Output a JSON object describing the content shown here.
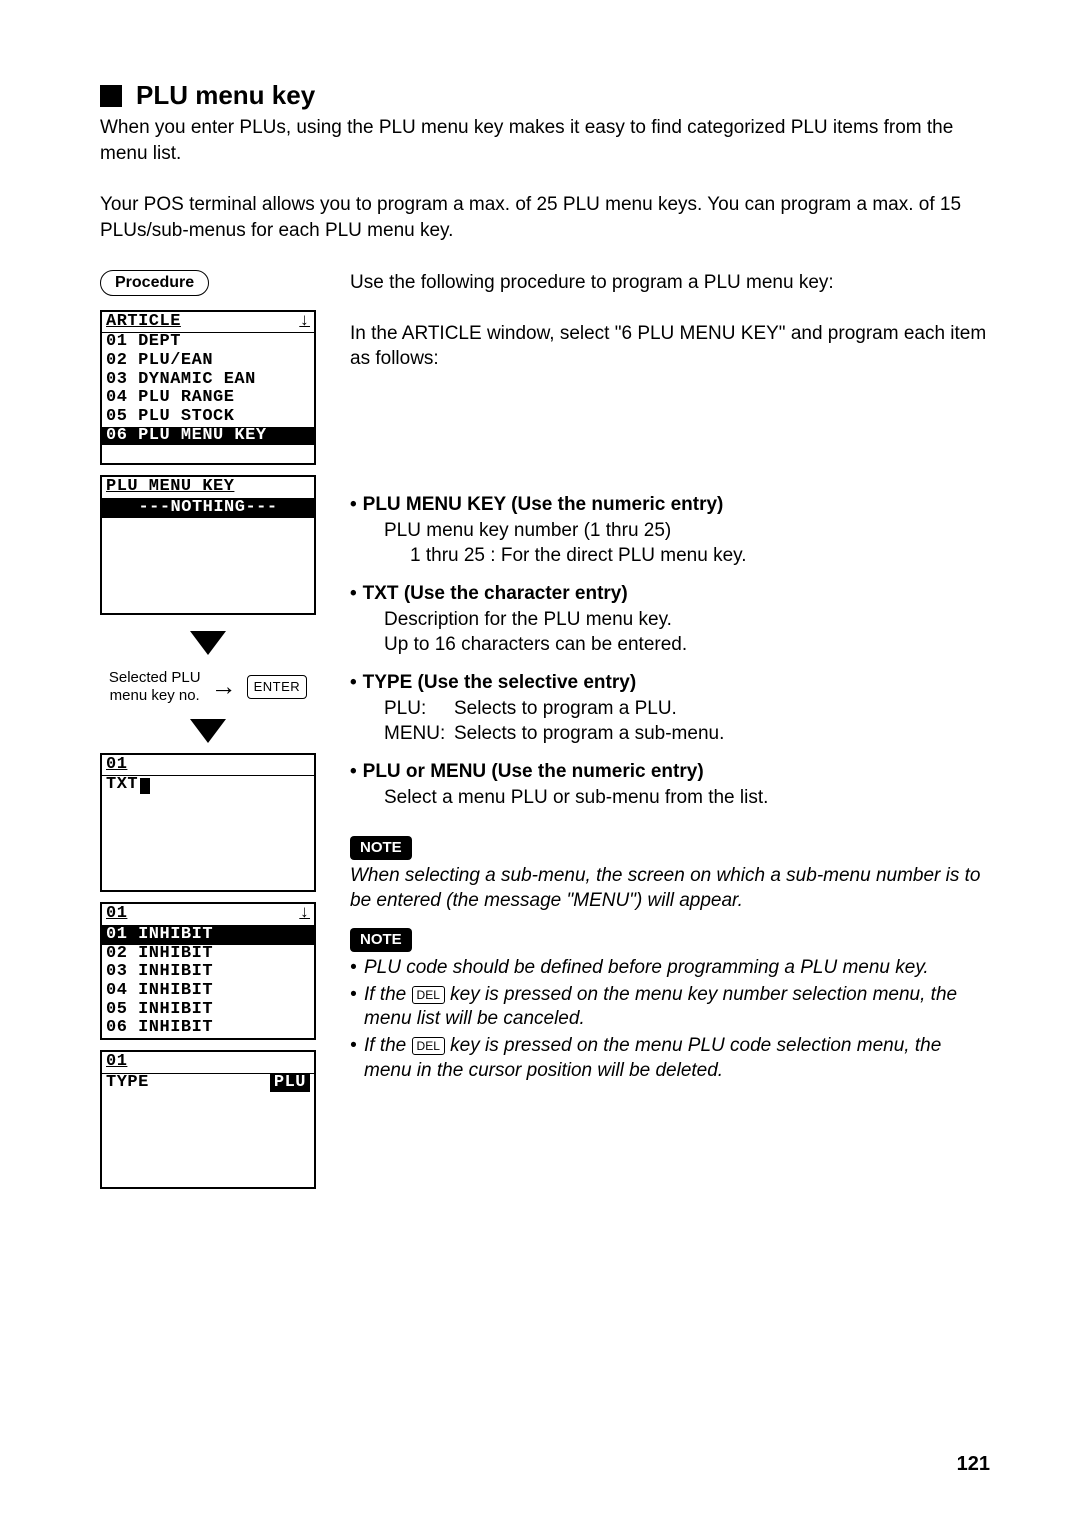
{
  "heading": "PLU menu key",
  "intro1": "When you enter PLUs, using the PLU menu key makes it easy to find categorized PLU items from the menu list.",
  "intro2": "Your POS terminal allows you to program a max. of 25 PLU menu keys. You can program a max. of 15 PLUs/sub-menus for each PLU menu key.",
  "procedure_label": "Procedure",
  "right_intro1": "Use the following procedure to program a PLU menu key:",
  "right_intro2": "In the ARTICLE window, select \"6 PLU MENU KEY\" and program each item as follows:",
  "lcd1": {
    "title": "ARTICLE",
    "arrow": "↓",
    "rows": [
      "01 DEPT",
      "02 PLU/EAN",
      "03 DYNAMIC EAN",
      "04 PLU RANGE",
      "05 PLU STOCK"
    ],
    "highlight": "06 PLU MENU KEY"
  },
  "lcd2": {
    "title": "PLU MENU KEY",
    "highlight": "---NOTHING---"
  },
  "step_label": "Selected PLU\nmenu key no.",
  "enter_label": "ENTER",
  "lcd3": {
    "title": "01",
    "field": "TXT"
  },
  "lcd4": {
    "title": "01",
    "arrow": "↓",
    "highlight": "01 INHIBIT",
    "rows": [
      "02 INHIBIT",
      "03 INHIBIT",
      "04 INHIBIT",
      "05 INHIBIT",
      "06 INHIBIT"
    ]
  },
  "lcd5": {
    "title": "01",
    "field": "TYPE",
    "value": "PLU"
  },
  "sections": [
    {
      "title": "PLU MENU KEY (Use the numeric entry)",
      "lines": [
        "PLU menu key number (1 thru 25)",
        "1 thru 25 : For the direct PLU menu key."
      ],
      "line2_indent": true
    },
    {
      "title": "TXT (Use the character entry)",
      "lines": [
        "Description for the PLU menu key.",
        "Up to 16 characters can be entered."
      ]
    },
    {
      "title": "TYPE (Use the selective entry)",
      "defs": [
        {
          "k": "PLU:",
          "v": "Selects to program a PLU."
        },
        {
          "k": "MENU:",
          "v": "Selects to program a sub-menu."
        }
      ]
    },
    {
      "title": "PLU or MENU (Use the numeric entry)",
      "lines": [
        "Select a menu PLU or sub-menu from the list."
      ]
    }
  ],
  "note_label": "NOTE",
  "note1": "When selecting a sub-menu, the screen on which a sub-menu number is to be entered (the message \"MENU\") will appear.",
  "note2": {
    "item1": "PLU code should be defined before programming a PLU menu key.",
    "item2a": "If the ",
    "item2b": " key is pressed on the menu key number selection menu, the menu list will be canceled.",
    "item3a": "If the ",
    "item3b": " key is pressed on the menu PLU code selection menu, the menu in the cursor position will be deleted.",
    "del": "DEL"
  },
  "page": "121"
}
